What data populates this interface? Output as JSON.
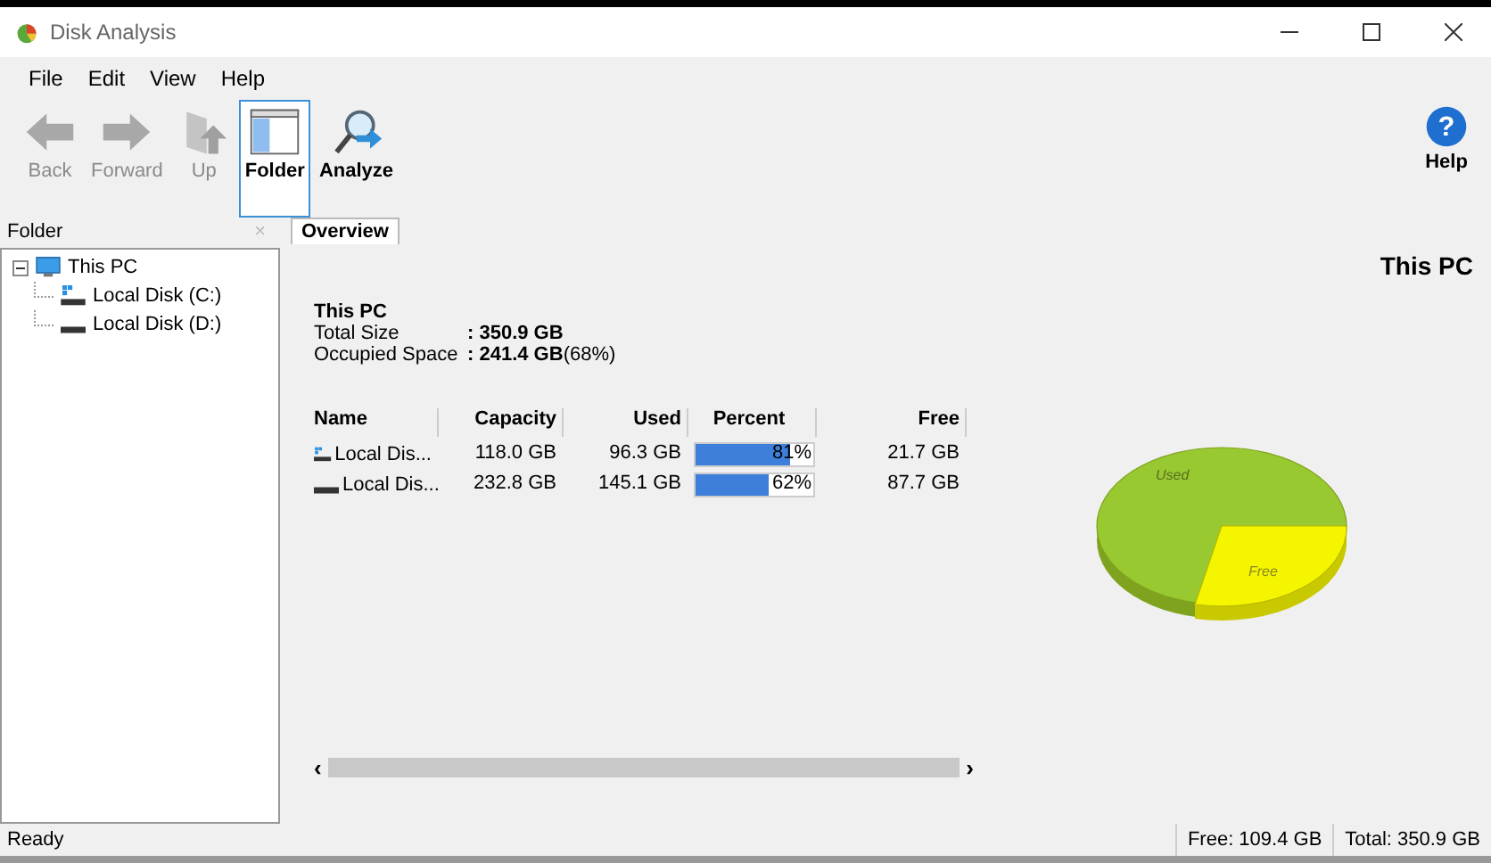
{
  "window": {
    "title": "Disk Analysis"
  },
  "menu": [
    "File",
    "Edit",
    "View",
    "Help"
  ],
  "toolbar": [
    {
      "label": "Back",
      "kind": "back",
      "disabled": true,
      "selected": false
    },
    {
      "label": "Forward",
      "kind": "forward",
      "disabled": true,
      "selected": false
    },
    {
      "label": "Up",
      "kind": "up",
      "disabled": true,
      "selected": false
    },
    {
      "label": "Folder",
      "kind": "folder",
      "disabled": false,
      "selected": true
    },
    {
      "label": "Analyze",
      "kind": "analyze",
      "disabled": false,
      "selected": false
    }
  ],
  "help_button": {
    "label": "Help",
    "glyph": "?"
  },
  "sidebar": {
    "title": "Folder",
    "close": "×",
    "tree": [
      {
        "label": "This PC",
        "kind": "pc",
        "expanded": true,
        "children": [
          {
            "label": "Local Disk (C:)",
            "kind": "sysdisk"
          },
          {
            "label": "Local Disk (D:)",
            "kind": "disk"
          }
        ]
      }
    ]
  },
  "tabs": [
    {
      "label": "Overview",
      "selected": true
    }
  ],
  "overview": {
    "heading": "This PC",
    "summary_title": "This PC",
    "summary": [
      {
        "label": "Total Size",
        "value": ": 350.9 GB"
      },
      {
        "label": "Occupied Space",
        "value": ": 241.4 GB",
        "note": "(68%)"
      }
    ],
    "table": {
      "columns": [
        "Name",
        "Capacity",
        "Used",
        "Percent",
        "Free"
      ],
      "rows": [
        {
          "name": "Local Dis...",
          "kind": "sysdisk",
          "capacity": "118.0 GB",
          "used": "96.3 GB",
          "level": 0.81,
          "percent": "81%",
          "free": "21.7 GB"
        },
        {
          "name": "Local Dis...",
          "kind": "disk",
          "capacity": "232.8 GB",
          "used": "145.1 GB",
          "level": 0.62,
          "percent": "62%",
          "free": "87.7 GB"
        }
      ]
    },
    "pie": {
      "labels": [
        "Used",
        "Free"
      ]
    },
    "scroll": {
      "left": "‹",
      "right": "›"
    }
  },
  "status_bar": {
    "text": "Ready",
    "free": "Free: 109.4 GB",
    "total": "Total: 350.9 GB"
  }
}
